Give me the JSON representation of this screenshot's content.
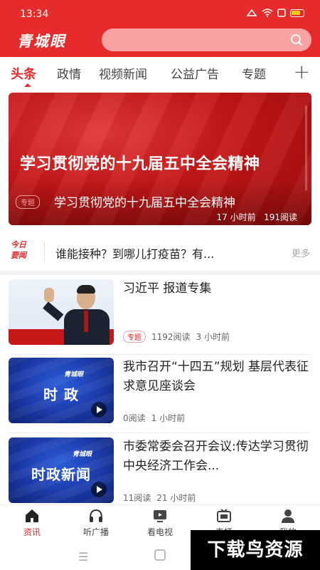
{
  "status_bar": {
    "time": "13:34",
    "icons": [
      "notification-icon",
      "wifi-icon",
      "sim-icon",
      "battery-icon"
    ]
  },
  "header": {
    "logo": "青城眼",
    "search": {
      "placeholder": ""
    },
    "accent": "#e52b2b"
  },
  "tabs": [
    {
      "label": "头条",
      "active": true
    },
    {
      "label": "政情",
      "active": false
    },
    {
      "label": "视频新闻",
      "active": false
    },
    {
      "label": "公益广告",
      "active": false
    },
    {
      "label": "专题",
      "active": false
    }
  ],
  "banner": {
    "headline": "学习贯彻党的十九届五中全会精神",
    "tag": "专题",
    "caption": "学习贯彻党的十九届五中全会精神",
    "time": "17 小时前",
    "reads": "191阅读"
  },
  "hot": {
    "badge_line1": "今日",
    "badge_line2": "要闻",
    "text": "谁能接种？到哪儿打疫苗？有...",
    "more": "更多"
  },
  "news": [
    {
      "title": "习近平 报道专集",
      "tag": "专题",
      "reads": "1192阅读",
      "time": "3 小时前",
      "thumb": "person"
    },
    {
      "title": "我市召开“十四五”规划 基层代表征求意见座谈会",
      "tag": "",
      "reads": "0阅读",
      "time": "1 小时前",
      "thumb": "blue",
      "thumb_logo": "青城眼",
      "thumb_word": "时 政"
    },
    {
      "title": "市委常委会召开会议:传达学习贯彻中央经济工作会...",
      "tag": "",
      "reads": "11阅读",
      "time": "21 小时前",
      "thumb": "blue",
      "thumb_logo": "青城眼",
      "thumb_word": "时政新闻"
    }
  ],
  "bottom_nav": [
    {
      "label": "资讯",
      "icon": "home-icon",
      "active": true
    },
    {
      "label": "听广播",
      "icon": "headphones-icon",
      "active": false
    },
    {
      "label": "看电视",
      "icon": "tv-icon",
      "active": false
    },
    {
      "label": "直播",
      "icon": "live-icon",
      "active": false
    },
    {
      "label": "我的",
      "icon": "user-icon",
      "active": false
    }
  ],
  "watermark": "下载鸟资源"
}
